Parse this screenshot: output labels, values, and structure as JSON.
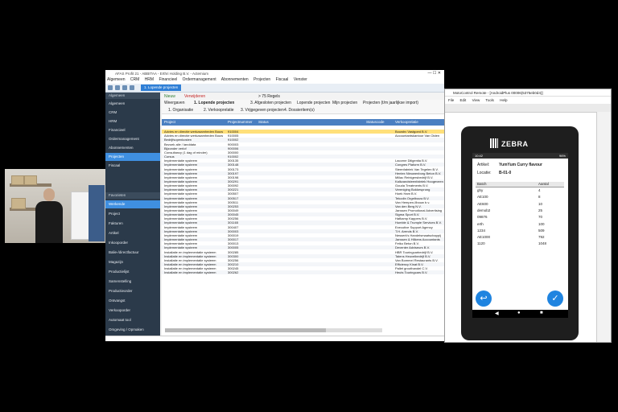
{
  "main_window": {
    "title": "AFAS Profit 21 - ABBITAA - Erthri Holding B.V. - Actemium",
    "menu": [
      "Algemeen",
      "CRM",
      "HRM",
      "Financieel",
      "Ordermanagement",
      "Abonnementen",
      "Projecten",
      "Fiscaal",
      "Venster"
    ],
    "active_tab": "1. Lopende projecten",
    "sidebar_section_1": "Algemeen",
    "sidebar_items_1": [
      "Algemeen",
      "CRM",
      "HRM",
      "Financieel",
      "Ordermanagement",
      "Abonnementen",
      "Projecten",
      "Fiscaal"
    ],
    "sidebar_section_2": "Favorieten",
    "sidebar_items_2": [
      "Werkende",
      "Project",
      "Fakturen",
      "Artikel",
      "Inkooporder",
      "Balie-/directfactuur",
      "Magazijn",
      "Productielijst",
      "Samenstelling",
      "Productieorder",
      "Ontvangst",
      "Verkooporder",
      "Automaat tool",
      "Omgeving / Opmaken"
    ],
    "toolbar_items": [
      "Nieuw",
      "Verwijderen",
      "> 75 Regels"
    ],
    "toolbar2_items": [
      "Weergaven",
      "1. Lopende projecten",
      "3. Afgesloten projecten",
      "Lopende projecten",
      "Mijn projecten",
      "Projecten (t/m jaarlijkse import)"
    ],
    "tabs": [
      "1. Organisatie",
      "2. Verkooprelatie",
      "3. Vrijgegeven projecten",
      "4. Dossieritem(s)"
    ],
    "columns": {
      "project": "Project",
      "projectnummer": "Projectnummer",
      "status": "Status",
      "statuscode": "Statuscode",
      "verkooprelatie": "Verkooprelatie"
    },
    "rows": [
      {
        "project": "",
        "nummer": "",
        "relatie": ""
      },
      {
        "project": "Advies en directie werkzaamheden Bouw",
        "nummer": "910004",
        "relatie": "Bouwbv Vastgoed B.V."
      },
      {
        "project": "Advies en directie werkzaamheden Bouw",
        "nummer": "910005",
        "relatie": "Accountantskantoor Van Olden"
      },
      {
        "project": "Bedrijfsopenkosten",
        "nummer": "910002",
        "relatie": ""
      },
      {
        "project": "Bezoek alle / landdata",
        "nummer": "900003",
        "relatie": ""
      },
      {
        "project": "Bijzonder verlof",
        "nummer": "900006",
        "relatie": ""
      },
      {
        "project": "Consultancy (1 dag of minder)",
        "nummer": "300000",
        "relatie": ""
      },
      {
        "project": "Cursus",
        "nummer": "910002",
        "relatie": ""
      },
      {
        "project": "Implementatie systeem",
        "nummer": "300135",
        "relatie": "Lacorne Diligentia B.V."
      },
      {
        "project": "Implementatie systeem",
        "nummer": "300148",
        "relatie": "Congres Plaform B.V."
      },
      {
        "project": "Implementatie systeem",
        "nummer": "300173",
        "relatie": "Steenfabriek Van Tegelen B.V."
      },
      {
        "project": "Implementatie systeem",
        "nummer": "300197",
        "relatie": "Hentex Nieuwenborg Beton B.V."
      },
      {
        "project": "Implementatie systeem",
        "nummer": "300198",
        "relatie": "Millac Reinigersbedrijf B.V."
      },
      {
        "project": "Implementatie systeem",
        "nummer": "300291",
        "relatie": "Kalkzandsteenfabriek Hoogeveen"
      },
      {
        "project": "Implementatie systeem",
        "nummer": "300092",
        "relatie": "Gouda Treatments B.V."
      },
      {
        "project": "Implementatie systeem",
        "nummer": "300221",
        "relatie": "Vereniging Bokkesprong"
      },
      {
        "project": "Implementatie systeem",
        "nummer": "300507",
        "relatie": "Hoek Ham B.V."
      },
      {
        "project": "Implementatie systeem",
        "nummer": "300517",
        "relatie": "Tekodin Orgelbouw B.V."
      },
      {
        "project": "Implementatie systeem",
        "nummer": "300511",
        "relatie": "Van Hempen-Ilbouw b.v."
      },
      {
        "project": "Implementatie systeem",
        "nummer": "300253",
        "relatie": "Van den Berg N.V."
      },
      {
        "project": "Implementatie systeem",
        "nummer": "300049",
        "relatie": "Janssen Promotional Advertising"
      },
      {
        "project": "Implementatie systeem",
        "nummer": "300045",
        "relatie": "Sigma Sport B.V."
      },
      {
        "project": "Implementatie systeem",
        "nummer": "300256",
        "relatie": "Hafkamp Kappers B.V."
      },
      {
        "project": "Implementatie systeem",
        "nummer": "301165",
        "relatie": "Humble & Trumple Services B.V."
      },
      {
        "project": "Implementatie systeem",
        "nummer": "300407",
        "relatie": "Executive Support Agency"
      },
      {
        "project": "Implementatie systeem",
        "nummer": "300003",
        "relatie": "T.H. Arends B.V."
      },
      {
        "project": "Implementatie systeem",
        "nummer": "300019",
        "relatie": "Nesserk's Handelsmaatschappij"
      },
      {
        "project": "Implementatie systeem",
        "nummer": "300017",
        "relatie": "Janssen & Hilkens Accountants"
      },
      {
        "project": "Implementatie systeem",
        "nummer": "300013",
        "relatie": "Fetko Beton B.V."
      },
      {
        "project": "Implementatie systeem",
        "nummer": "300005",
        "relatie": "Deventer Adviseurs B.V."
      },
      {
        "project": "Installatie en implementatie systeem",
        "nummer": "300285",
        "relatie": "HBR Touringcarbedrijf B.V."
      },
      {
        "project": "Installatie en implementatie systeem",
        "nummer": "300300",
        "relatie": "Talens Heuvelbedrijf B.V."
      },
      {
        "project": "Installatie en implementatie systeem",
        "nummer": "300256",
        "relatie": "Van Bommel Restaurants B.V."
      },
      {
        "project": "Installatie en implementatie systeem",
        "nummer": "300210",
        "relatie": "Efficiency Kinat B.V."
      },
      {
        "project": "Installatie en implementatie systeem",
        "nummer": "300245",
        "relatie": "Pallet groothandel C.V."
      },
      {
        "project": "Installatie en implementatie systeem",
        "nummer": "300262",
        "relatie": "Heuts Touringcars B.V."
      }
    ]
  },
  "remote_window": {
    "title": "MotoControl Remote - [AndroidPlus 00006(5375eb0d4)]",
    "menu": [
      "File",
      "Edit",
      "View",
      "Tools",
      "Help"
    ]
  },
  "device": {
    "brand": "ZEBRA",
    "time": "10:42",
    "battery": "96%",
    "artikel_label": "Artikel:",
    "artikel_value": "YumYum Curry flavour",
    "locatie_label": "Locatie:",
    "locatie_value": "B-01-0",
    "batch_header": "Batch",
    "aantal_header": "Aantal",
    "batches": [
      {
        "batch": "ghy",
        "aantal": "4"
      },
      {
        "batch": "AE100",
        "aantal": "8"
      },
      {
        "batch": "AE600",
        "aantal": "10"
      },
      {
        "batch": "demob2",
        "aantal": "25"
      },
      {
        "batch": "09876",
        "aantal": "70"
      },
      {
        "batch": "erth",
        "aantal": "100"
      },
      {
        "batch": "1234",
        "aantal": "509"
      },
      {
        "batch": "AE1000",
        "aantal": "792"
      },
      {
        "batch": "1120",
        "aantal": "1048"
      }
    ],
    "back_glyph": "↩",
    "ok_glyph": "✓",
    "nav": [
      "◀",
      "●",
      "■"
    ]
  }
}
